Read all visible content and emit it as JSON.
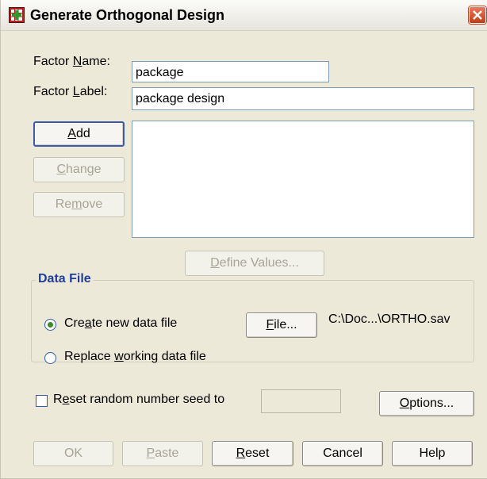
{
  "window": {
    "title": "Generate Orthogonal Design",
    "icon": "spss-grid-icon",
    "close_icon": "close-icon",
    "close_color": "#d9532e"
  },
  "factor": {
    "name_label_pre": "Factor ",
    "name_label_u": "N",
    "name_label_post": "ame:",
    "name_value": "package",
    "label_label_pre": "Factor ",
    "label_label_u": "L",
    "label_label_post": "abel:",
    "label_value": "package design"
  },
  "buttons": {
    "add": {
      "pre": "",
      "u": "A",
      "post": "dd"
    },
    "change": {
      "pre": "",
      "u": "C",
      "post": "hange"
    },
    "remove": {
      "pre": "Re",
      "u": "m",
      "post": "ove"
    },
    "define_values": {
      "pre": "",
      "u": "D",
      "post": "efine Values..."
    }
  },
  "data_file": {
    "title": "Data File",
    "create": {
      "pre": "Cre",
      "u": "a",
      "post": "te new data file",
      "selected": true
    },
    "replace": {
      "pre": "Replace ",
      "u": "w",
      "post": "orking data file",
      "selected": false
    },
    "file_button": {
      "pre": "",
      "u": "F",
      "post": "ile..."
    },
    "path": "C:\\Doc...\\ORTHO.sav"
  },
  "seed": {
    "pre": "R",
    "u": "e",
    "post": "set random number seed to",
    "checked": false,
    "value": ""
  },
  "options_button": {
    "pre": "",
    "u": "O",
    "post": "ptions..."
  },
  "bottom_buttons": {
    "ok": "OK",
    "paste": {
      "pre": "",
      "u": "P",
      "post": "aste"
    },
    "reset": {
      "pre": "",
      "u": "R",
      "post": "eset"
    },
    "cancel": "Cancel",
    "help": "Help"
  },
  "colors": {
    "dialog_bg": "#ece9d8",
    "accent": "#1f3d99",
    "radio_dot": "#3d8a2b"
  }
}
